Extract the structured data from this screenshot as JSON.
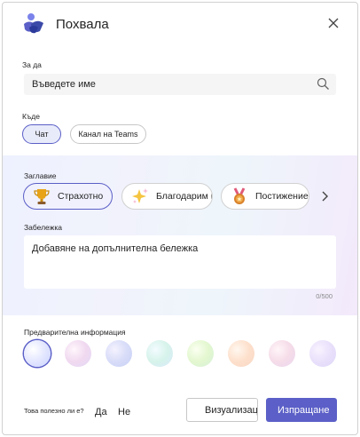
{
  "dialog": {
    "title": "Похвала"
  },
  "to": {
    "label": "За да",
    "placeholder": "Въведете име"
  },
  "where": {
    "label": "Къде",
    "options": [
      "Чат",
      "Канал на Teams"
    ],
    "selected": "Чат"
  },
  "badges": {
    "label": "Заглавие",
    "items": [
      {
        "label": "Страхотно",
        "icon": "trophy-icon"
      },
      {
        "label": "Благодарим ви",
        "icon": "sparkles-icon"
      },
      {
        "label": "Постижение",
        "icon": "medal-icon"
      }
    ],
    "selected": "Страхотно"
  },
  "note": {
    "label": "Забележка",
    "placeholder": "Добавяне на допълнителна бележка",
    "counter": "0/500"
  },
  "preview": {
    "label": "Предварителна информация",
    "swatch_count": 8
  },
  "footer": {
    "question": "Това полезно ли е?",
    "yes": "Да",
    "no": "Не",
    "preview_button": "Визуализация",
    "send_button": "Изпращане"
  },
  "colors": {
    "accent": "#5b5fc7",
    "swatches": [
      "#e4e8ff",
      "#f3dff2",
      "#dfe3fb",
      "#d9f5e8",
      "#e7f8d4",
      "#fde3d2",
      "#f5dde9",
      "#ece6fb"
    ]
  }
}
